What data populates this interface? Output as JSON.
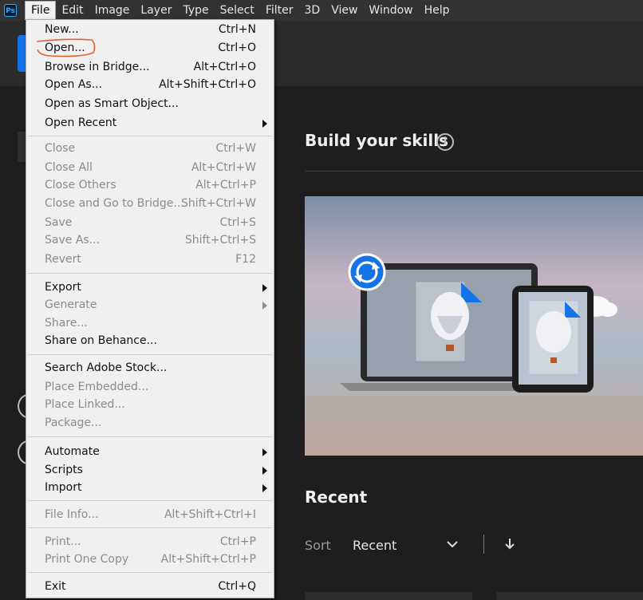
{
  "app": {
    "logo_text": "Ps"
  },
  "menubar": {
    "items": [
      "File",
      "Edit",
      "Image",
      "Layer",
      "Type",
      "Select",
      "Filter",
      "3D",
      "View",
      "Window",
      "Help"
    ]
  },
  "file_menu": {
    "groups": [
      [
        {
          "label": "New...",
          "shortcut": "Ctrl+N",
          "enabled": true
        },
        {
          "label": "Open...",
          "shortcut": "Ctrl+O",
          "enabled": true
        },
        {
          "label": "Browse in Bridge...",
          "shortcut": "Alt+Ctrl+O",
          "enabled": true
        },
        {
          "label": "Open As...",
          "shortcut": "Alt+Shift+Ctrl+O",
          "enabled": true
        },
        {
          "label": "Open as Smart Object...",
          "shortcut": "",
          "enabled": true
        },
        {
          "label": "Open Recent",
          "shortcut": "",
          "enabled": true,
          "submenu": true
        }
      ],
      [
        {
          "label": "Close",
          "shortcut": "Ctrl+W",
          "enabled": false
        },
        {
          "label": "Close All",
          "shortcut": "Alt+Ctrl+W",
          "enabled": false
        },
        {
          "label": "Close Others",
          "shortcut": "Alt+Ctrl+P",
          "enabled": false
        },
        {
          "label": "Close and Go to Bridge...",
          "shortcut": "Shift+Ctrl+W",
          "enabled": false
        },
        {
          "label": "Save",
          "shortcut": "Ctrl+S",
          "enabled": false
        },
        {
          "label": "Save As...",
          "shortcut": "Shift+Ctrl+S",
          "enabled": false
        },
        {
          "label": "Revert",
          "shortcut": "F12",
          "enabled": false
        }
      ],
      [
        {
          "label": "Export",
          "shortcut": "",
          "enabled": true,
          "submenu": true
        },
        {
          "label": "Generate",
          "shortcut": "",
          "enabled": false,
          "submenu": true
        },
        {
          "label": "Share...",
          "shortcut": "",
          "enabled": false
        },
        {
          "label": "Share on Behance...",
          "shortcut": "",
          "enabled": true
        }
      ],
      [
        {
          "label": "Search Adobe Stock...",
          "shortcut": "",
          "enabled": true
        },
        {
          "label": "Place Embedded...",
          "shortcut": "",
          "enabled": false
        },
        {
          "label": "Place Linked...",
          "shortcut": "",
          "enabled": false
        },
        {
          "label": "Package...",
          "shortcut": "",
          "enabled": false
        }
      ],
      [
        {
          "label": "Automate",
          "shortcut": "",
          "enabled": true,
          "submenu": true
        },
        {
          "label": "Scripts",
          "shortcut": "",
          "enabled": true,
          "submenu": true
        },
        {
          "label": "Import",
          "shortcut": "",
          "enabled": true,
          "submenu": true
        }
      ],
      [
        {
          "label": "File Info...",
          "shortcut": "Alt+Shift+Ctrl+I",
          "enabled": false
        }
      ],
      [
        {
          "label": "Print...",
          "shortcut": "Ctrl+P",
          "enabled": false
        },
        {
          "label": "Print One Copy",
          "shortcut": "Alt+Shift+Ctrl+P",
          "enabled": false
        }
      ],
      [
        {
          "label": "Exit",
          "shortcut": "Ctrl+Q",
          "enabled": true
        }
      ]
    ]
  },
  "home": {
    "skills_title": "Build your skills",
    "recent_title": "Recent",
    "sort_label": "Sort",
    "sort_value": "Recent"
  },
  "colors": {
    "accent": "#1473e6",
    "annotation": "#e8612c",
    "menu_bg": "#f0f0f0",
    "app_bg": "#1e1e1e"
  }
}
